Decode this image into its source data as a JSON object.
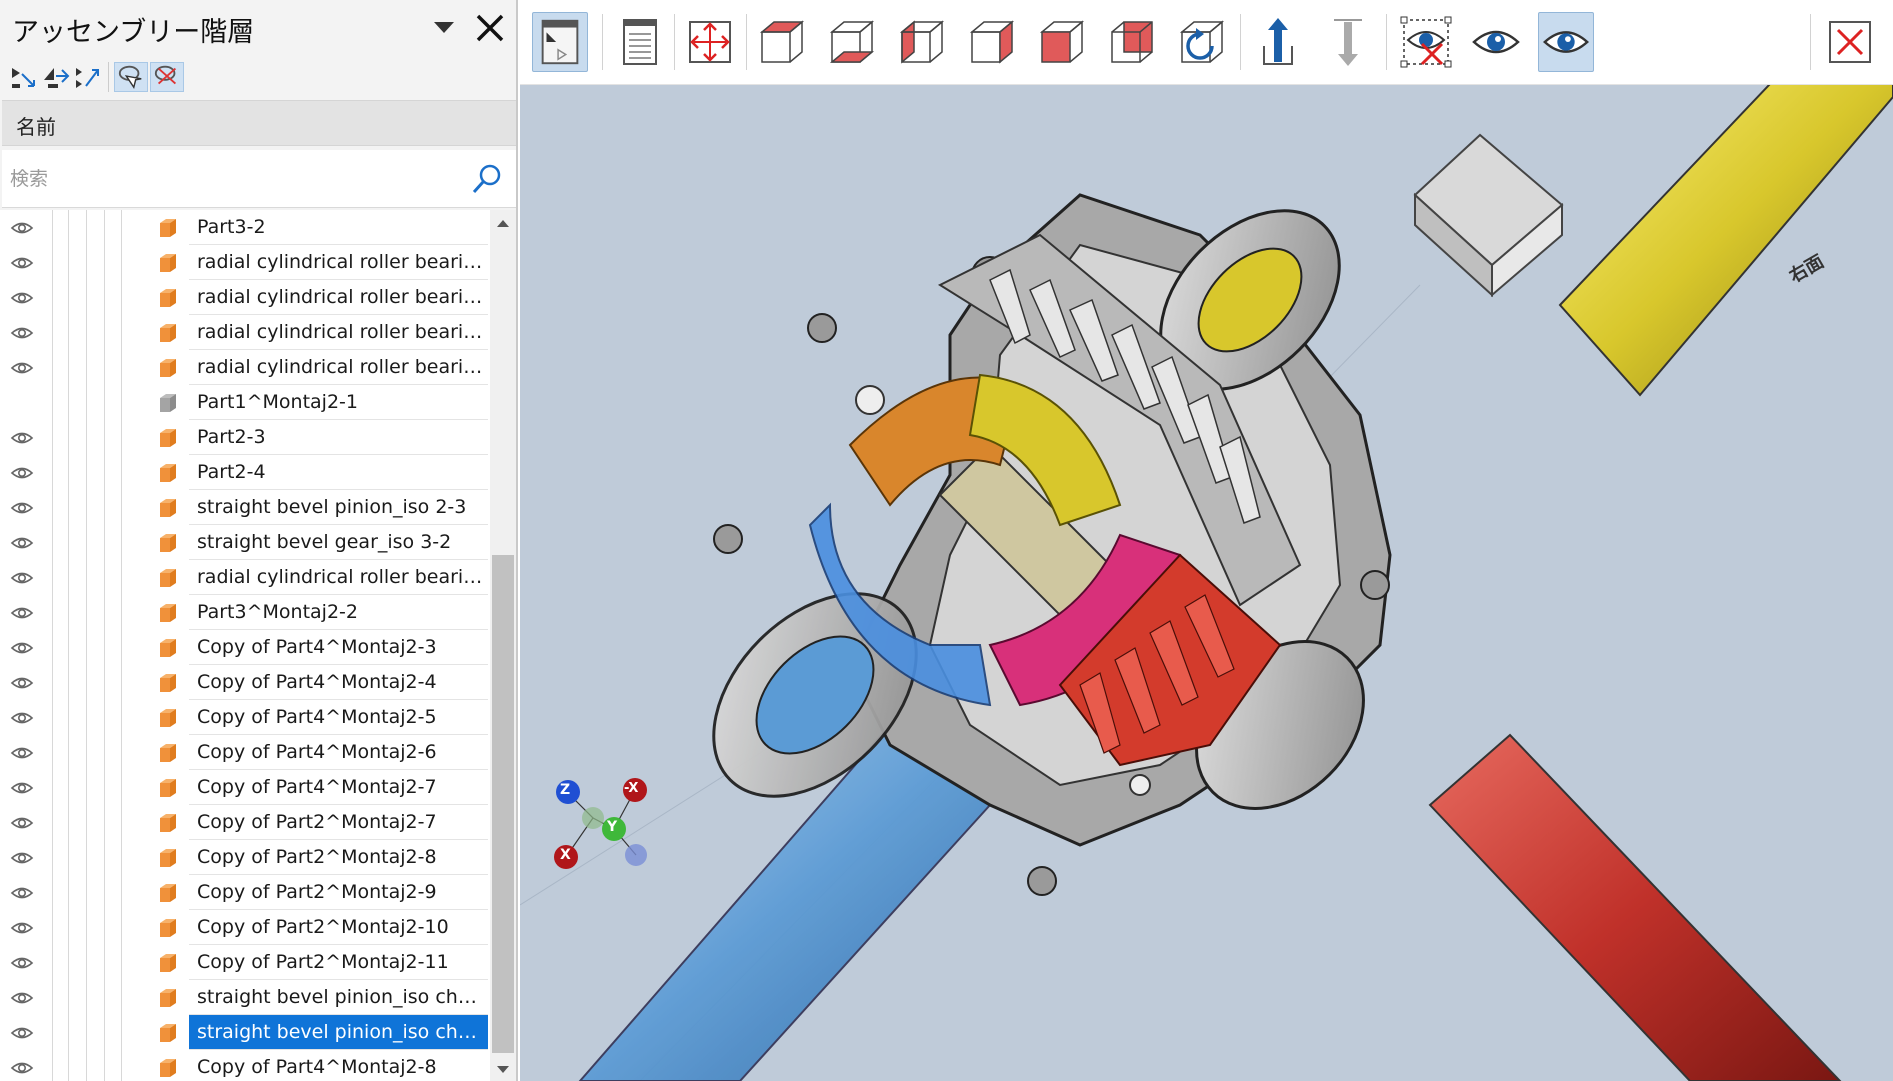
{
  "panel": {
    "title": "アッセンブリー階層",
    "column_header": "名前",
    "search": {
      "placeholder": "検索",
      "value": ""
    }
  },
  "tree_items": [
    {
      "label": "Part3-2",
      "visible": true,
      "cube": "orange",
      "selected": false
    },
    {
      "label": "radial cylindrical roller beari…",
      "visible": true,
      "cube": "orange",
      "selected": false
    },
    {
      "label": "radial cylindrical roller beari…",
      "visible": true,
      "cube": "orange",
      "selected": false
    },
    {
      "label": "radial cylindrical roller beari…",
      "visible": true,
      "cube": "orange",
      "selected": false
    },
    {
      "label": "radial cylindrical roller beari…",
      "visible": true,
      "cube": "orange",
      "selected": false
    },
    {
      "label": "Part1^Montaj2-1",
      "visible": false,
      "cube": "gray",
      "selected": false
    },
    {
      "label": "Part2-3",
      "visible": true,
      "cube": "orange",
      "selected": false
    },
    {
      "label": "Part2-4",
      "visible": true,
      "cube": "orange",
      "selected": false
    },
    {
      "label": "straight bevel pinion_iso 2-3",
      "visible": true,
      "cube": "orange",
      "selected": false
    },
    {
      "label": "straight bevel gear_iso 3-2",
      "visible": true,
      "cube": "orange",
      "selected": false
    },
    {
      "label": "radial cylindrical roller beari…",
      "visible": true,
      "cube": "orange",
      "selected": false
    },
    {
      "label": "Part3^Montaj2-2",
      "visible": true,
      "cube": "orange",
      "selected": false
    },
    {
      "label": "Copy of Part4^Montaj2-3",
      "visible": true,
      "cube": "orange",
      "selected": false
    },
    {
      "label": "Copy of Part4^Montaj2-4",
      "visible": true,
      "cube": "orange",
      "selected": false
    },
    {
      "label": "Copy of Part4^Montaj2-5",
      "visible": true,
      "cube": "orange",
      "selected": false
    },
    {
      "label": "Copy of Part4^Montaj2-6",
      "visible": true,
      "cube": "orange",
      "selected": false
    },
    {
      "label": "Copy of Part4^Montaj2-7",
      "visible": true,
      "cube": "orange",
      "selected": false
    },
    {
      "label": "Copy of Part2^Montaj2-7",
      "visible": true,
      "cube": "orange",
      "selected": false
    },
    {
      "label": "Copy of Part2^Montaj2-8",
      "visible": true,
      "cube": "orange",
      "selected": false
    },
    {
      "label": "Copy of Part2^Montaj2-9",
      "visible": true,
      "cube": "orange",
      "selected": false
    },
    {
      "label": "Copy of Part2^Montaj2-10",
      "visible": true,
      "cube": "orange",
      "selected": false
    },
    {
      "label": "Copy of Part2^Montaj2-11",
      "visible": true,
      "cube": "orange",
      "selected": false
    },
    {
      "label": "straight bevel pinion_iso ch…",
      "visible": true,
      "cube": "orange",
      "selected": false
    },
    {
      "label": "straight bevel pinion_iso ch…",
      "visible": true,
      "cube": "orange",
      "selected": true
    },
    {
      "label": "Copy of Part4^Montaj2-8",
      "visible": true,
      "cube": "orange",
      "selected": false
    }
  ],
  "viewport": {
    "view_cube_face": "右面",
    "axes": {
      "z": "Z",
      "x": "X",
      "y": "Y",
      "neg_x": "-X"
    }
  },
  "colors": {
    "selection": "#0f74d8",
    "viewport_bg": "#bfcbd9",
    "shaft_yellow": "#d4c416",
    "shaft_red": "#c0312a",
    "shaft_blue": "#5b9bd5",
    "gear_red": "#d33b2c",
    "gear_yellow": "#d8c72c",
    "gear_orange": "#d9862c",
    "gear_magenta": "#d8307a",
    "gear_blue": "#4a8fe0",
    "housing": "#9a9a9a"
  }
}
